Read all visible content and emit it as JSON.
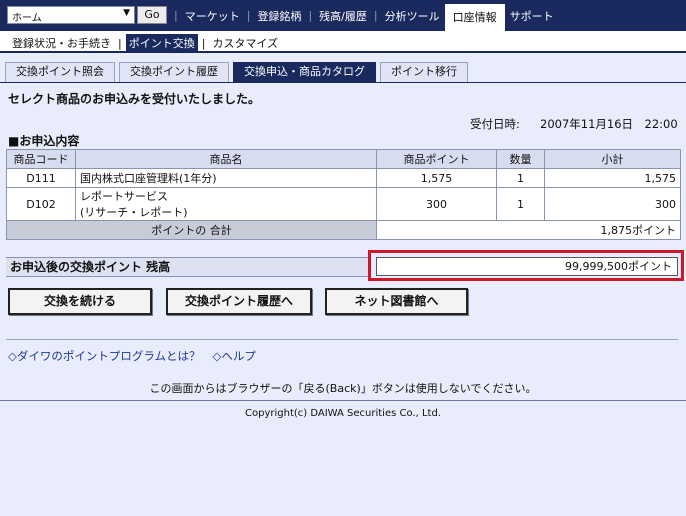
{
  "topbar": {
    "select_value": "ホーム",
    "go_label": "Go",
    "nav": [
      {
        "label": "マーケット"
      },
      {
        "label": "登録銘柄"
      },
      {
        "label": "残高/履歴"
      },
      {
        "label": "分析ツール"
      },
      {
        "label": "口座情報"
      },
      {
        "label": "サポート"
      }
    ]
  },
  "subnav": {
    "items": [
      {
        "label": "登録状況・お手続き"
      },
      {
        "label": "ポイント交換"
      },
      {
        "label": "カスタマイズ"
      }
    ]
  },
  "tabs": [
    {
      "label": "交換ポイント照会"
    },
    {
      "label": "交換ポイント履歴"
    },
    {
      "label": "交換申込・商品カタログ"
    },
    {
      "label": "ポイント移行"
    }
  ],
  "message": "セレクト商品のお申込みを受付いたしました。",
  "received": {
    "label": "受付日時:",
    "value": "2007年11月16日　22:00"
  },
  "section_title": "■お申込内容",
  "table": {
    "headers": [
      "商品コード",
      "商品名",
      "商品ポイント",
      "数量",
      "小計"
    ],
    "rows": [
      {
        "code": "D111",
        "name": "国内株式口座管理料(1年分)",
        "name2": "",
        "points": "1,575",
        "qty": "1",
        "subtotal": "1,575"
      },
      {
        "code": "D102",
        "name": "レポートサービス",
        "name2": "(リサーチ・レポート)",
        "points": "300",
        "qty": "1",
        "subtotal": "300"
      }
    ],
    "total_label": "ポイントの 合計",
    "total_value": "1,875ポイント"
  },
  "balance": {
    "label": "お申込後の交換ポイント 残高",
    "value": "99,999,500ポイント"
  },
  "buttons": {
    "continue": "交換を続ける",
    "history": "交換ポイント履歴へ",
    "library": "ネット図書館へ"
  },
  "links": {
    "program": "◇ダイワのポイントプログラムとは？",
    "help": "◇ヘルプ"
  },
  "notice": "この画面からはブラウザーの「戻る(Back)」ボタンは使用しないでください。",
  "copyright": "Copyright(c) DAIWA Securities Co., Ltd.",
  "colors": {
    "navy": "#1a2a5e",
    "highlight": "#d0162a",
    "background": "#e9ecfb"
  }
}
